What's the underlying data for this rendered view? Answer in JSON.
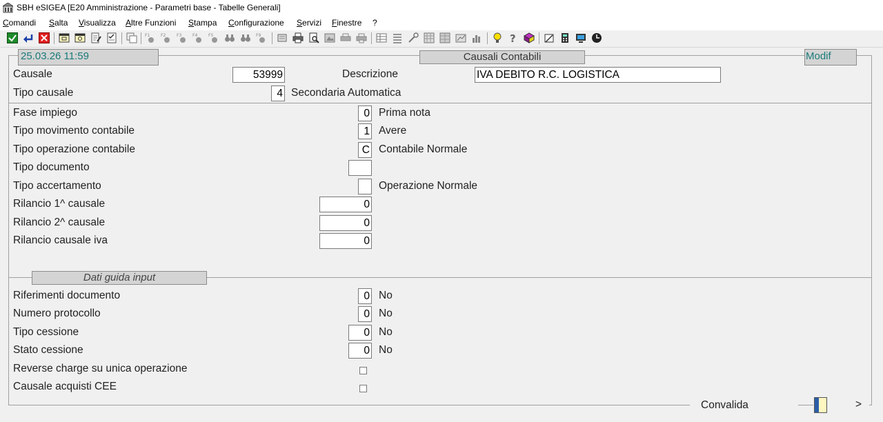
{
  "window": {
    "title": "SBH eSIGEA [E20 Amministrazione - Parametri base - Tabelle Generali]"
  },
  "menu": [
    "Comandi",
    "Salta",
    "Visualizza",
    "Altre Funzioni",
    "Stampa",
    "Configurazione",
    "Servizi",
    "Finestre",
    "?"
  ],
  "toolbar": {
    "icons": [
      "confirm-check-icon",
      "return-enter-icon",
      "close-x-icon",
      "window-icon",
      "window-alt-icon",
      "edit-icon",
      "checklist-icon",
      "copy-icon",
      "f1-icon",
      "f2-icon",
      "f3-icon",
      "f4-icon",
      "f5-icon",
      "binoculars-icon",
      "binoculars-next-icon",
      "f9-icon",
      "scroll-icon",
      "print-icon",
      "print-preview-icon",
      "image-icon",
      "printer-alt-icon",
      "printer-queue-icon",
      "table-icon",
      "list-icon",
      "tools-icon",
      "grid-icon",
      "grid-alt-icon",
      "chart-icon",
      "bar-chart-icon",
      "lightbulb-icon",
      "help-question-icon",
      "book-icon",
      "notepad-icon",
      "calculator-icon",
      "monitor-icon",
      "clock-icon"
    ]
  },
  "header": {
    "datetime": "25.03.26 11:59",
    "section_title": "Causali Contabili",
    "mode": "Modif"
  },
  "form": {
    "causale_label": "Causale",
    "causale_value": "53999",
    "descrizione_label": "Descrizione",
    "descrizione_value": "IVA DEBITO R.C. LOGISTICA",
    "tipo_causale_label": "Tipo causale",
    "tipo_causale_value": "4",
    "tipo_causale_desc": "Secondaria Automatica",
    "fase_impiego_label": "Fase impiego",
    "fase_impiego_value": "0",
    "fase_impiego_desc": "Prima nota",
    "tipo_movimento_label": "Tipo movimento contabile",
    "tipo_movimento_value": "1",
    "tipo_movimento_desc": "Avere",
    "tipo_operazione_label": "Tipo operazione contabile",
    "tipo_operazione_value": "C",
    "tipo_operazione_desc": "Contabile Normale",
    "tipo_documento_label": "Tipo documento",
    "tipo_documento_value": "",
    "tipo_accertamento_label": "Tipo accertamento",
    "tipo_accertamento_value": "",
    "tipo_accertamento_desc": "Operazione Normale",
    "rilancio1_label": "Rilancio 1^ causale",
    "rilancio1_value": "0",
    "rilancio2_label": "Rilancio 2^ causale",
    "rilancio2_value": "0",
    "rilancio_iva_label": "Rilancio causale iva",
    "rilancio_iva_value": "0"
  },
  "guida": {
    "section_title": "Dati guida input",
    "rif_doc_label": "Riferimenti documento",
    "rif_doc_value": "0",
    "rif_doc_desc": "No",
    "num_prot_label": "Numero protocollo",
    "num_prot_value": "0",
    "num_prot_desc": "No",
    "tipo_cess_label": "Tipo cessione",
    "tipo_cess_value": "0",
    "tipo_cess_desc": "No",
    "stato_cess_label": "Stato cessione",
    "stato_cess_value": "0",
    "stato_cess_desc": "No",
    "reverse_label": "Reverse charge su unica operazione",
    "reverse_checked": false,
    "cee_label": "Causale acquisti CEE",
    "cee_checked": false
  },
  "footer": {
    "convalida_label": "Convalida",
    "next_label": ">"
  },
  "colors": {
    "accent_teal": "#1a7a7a",
    "header_gray": "#d4d4d4",
    "red": "#e02020",
    "green": "#1d8a2a",
    "blue": "#1a3fa8"
  }
}
